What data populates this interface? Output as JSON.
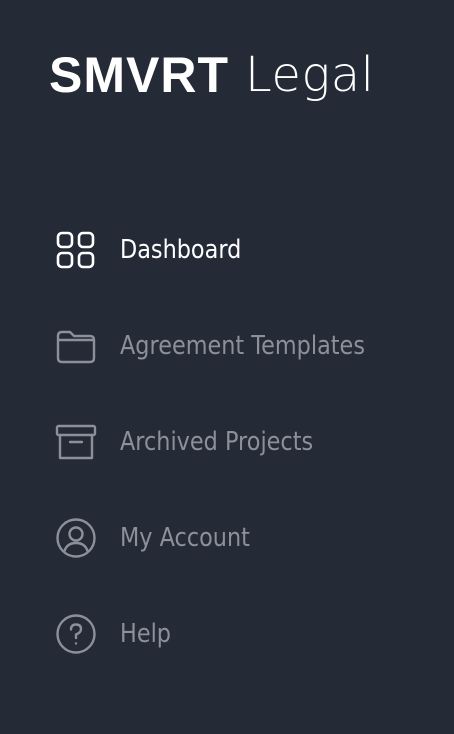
{
  "brand": {
    "name_bold": "SMVRT",
    "name_light": "Legal"
  },
  "sidebar": {
    "items": [
      {
        "label": "Dashboard",
        "icon": "dashboard-grid-icon",
        "active": true
      },
      {
        "label": "Agreement Templates",
        "icon": "folder-icon",
        "active": false
      },
      {
        "label": "Archived Projects",
        "icon": "archive-box-icon",
        "active": false
      },
      {
        "label": "My Account",
        "icon": "user-circle-icon",
        "active": false
      },
      {
        "label": "Help",
        "icon": "help-circle-icon",
        "active": false
      }
    ]
  },
  "colors": {
    "background": "#242a36",
    "active": "#ffffff",
    "inactive": "#8b9099"
  }
}
